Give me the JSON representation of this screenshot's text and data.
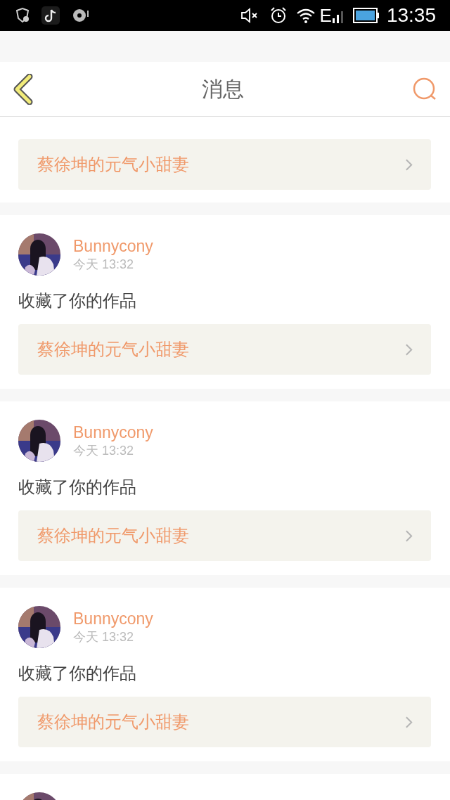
{
  "status_bar": {
    "network": "E",
    "time": "13:35"
  },
  "header": {
    "title": "消息"
  },
  "top_card": {
    "work": "蔡徐坤的元气小甜妻"
  },
  "messages": [
    {
      "user": "Bunnycony",
      "time": "今天 13:32",
      "action": "收藏了你的作品",
      "work": "蔡徐坤的元气小甜妻"
    },
    {
      "user": "Bunnycony",
      "time": "今天 13:32",
      "action": "收藏了你的作品",
      "work": "蔡徐坤的元气小甜妻"
    },
    {
      "user": "Bunnycony",
      "time": "今天 13:32",
      "action": "收藏了你的作品",
      "work": "蔡徐坤的元气小甜妻"
    }
  ]
}
